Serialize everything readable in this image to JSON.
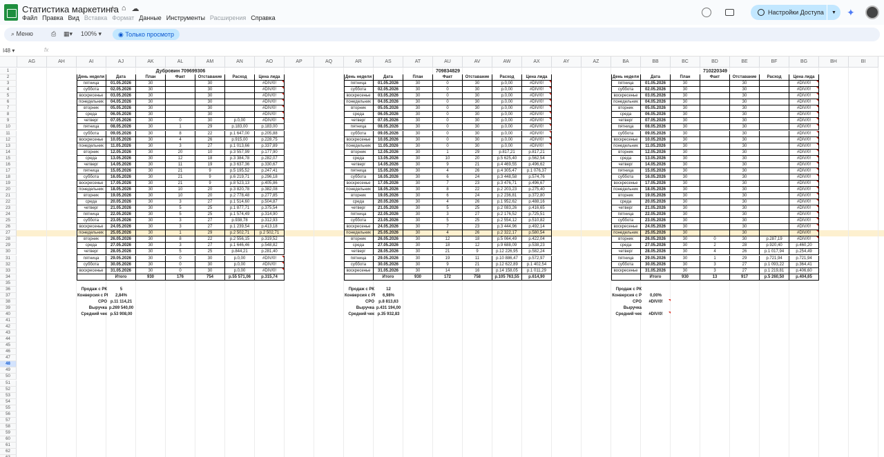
{
  "doc": {
    "title": "Статистика маркетинга",
    "menu": [
      "Файл",
      "Правка",
      "Вид",
      "Вставка",
      "Формат",
      "Данные",
      "Инструменты",
      "Расширения",
      "Справка"
    ],
    "menu_disabled": [
      3,
      4,
      7
    ]
  },
  "share": {
    "label": "Настройки Доступа"
  },
  "toolbar": {
    "search": "Меню",
    "zoom": "100%",
    "mode": "Только просмотр"
  },
  "formula": {
    "namebox": "I48",
    "fx": "fx"
  },
  "columns": [
    "AG",
    "AH",
    "AI",
    "AJ",
    "AK",
    "AL",
    "AM",
    "AN",
    "AO",
    "AP",
    "AQ",
    "AR",
    "AS",
    "AT",
    "AU",
    "AV",
    "AW",
    "AX",
    "AY",
    "AZ",
    "BA",
    "BB",
    "BC",
    "BD",
    "BE",
    "BF",
    "BG",
    "BH",
    "BI"
  ],
  "selected_row": 48,
  "highlight_row": 27,
  "headers": [
    "День недели",
    "Дата",
    "План",
    "Факт",
    "Отставание",
    "Расход",
    "Цена лида"
  ],
  "days": [
    "пятница",
    "суббота",
    "воскресенье",
    "понедельник",
    "вторник",
    "среда",
    "четверг",
    "пятница",
    "суббота",
    "воскресенье",
    "понедельник",
    "вторник",
    "среда",
    "четверг",
    "пятница",
    "суббота",
    "воскресенье",
    "понедельник",
    "вторник",
    "среда",
    "четверг",
    "пятница",
    "суббота",
    "воскресенье",
    "понедельник",
    "вторник",
    "среда",
    "четверг",
    "пятница",
    "суббота",
    "воскресенье"
  ],
  "dates": [
    "01.05.2026",
    "02.05.2026",
    "03.05.2026",
    "04.05.2026",
    "05.05.2026",
    "06.05.2026",
    "07.05.2026",
    "08.05.2026",
    "09.05.2026",
    "10.05.2026",
    "11.05.2026",
    "12.05.2026",
    "13.05.2026",
    "14.05.2026",
    "15.05.2026",
    "16.05.2026",
    "17.05.2026",
    "18.05.2026",
    "19.05.2026",
    "20.05.2026",
    "21.05.2026",
    "22.05.2026",
    "23.05.2026",
    "24.05.2026",
    "25.05.2026",
    "26.05.2026",
    "27.05.2026",
    "28.05.2026",
    "29.05.2026",
    "30.05.2026",
    "31.05.2026"
  ],
  "tables": [
    {
      "title": "Дубровин 709699306",
      "fact": [
        "",
        "",
        "",
        "",
        "",
        "",
        "0",
        "1",
        "8",
        "4",
        "3",
        "20",
        "12",
        "11",
        "21",
        "21",
        "21",
        "10",
        "10",
        "3",
        "5",
        "5",
        "3",
        "3",
        "1",
        "8",
        "3",
        "5",
        "0",
        "0",
        "0"
      ],
      "lag": [
        "30",
        "30",
        "30",
        "30",
        "30",
        "30",
        "30",
        "29",
        "22",
        "26",
        "27",
        "10",
        "18",
        "19",
        "9",
        "9",
        "9",
        "20",
        "20",
        "27",
        "25",
        "25",
        "27",
        "27",
        "29",
        "22",
        "27",
        "25",
        "30",
        "30",
        "30"
      ],
      "cost": [
        "",
        "",
        "",
        "",
        "",
        "",
        "р.0,00",
        "р.183,00",
        "р.1 647,00",
        "р.915,00",
        "р.1 013,66",
        "р.3 557,99",
        "р.3 384,78",
        "р.3 637,36",
        "р.5 195,52",
        "р.6 219,71",
        "р.8 523,13",
        "р.3 820,78",
        "р.2 778,48",
        "р.1 514,60",
        "р.1 877,71",
        "р.1 574,49",
        "р.938,78",
        "р.1 239,54",
        "р.2 502,71",
        "р.2 556,15",
        "р.1 646,46",
        "р.844,21",
        "р.0,00",
        "р.0,00",
        "р.0,00"
      ],
      "lead": [
        "#DIV/0!",
        "#DIV/0!",
        "#DIV/0!",
        "#DIV/0!",
        "#DIV/0!",
        "#DIV/0!",
        "#DIV/0!",
        "р.183,00",
        "р.205,88",
        "р.228,75",
        "р.337,89",
        "р.177,90",
        "р.282,07",
        "р.330,67",
        "р.247,41",
        "р.296,18",
        "р.405,86",
        "р.382,08",
        "р.277,85",
        "р.504,87",
        "р.375,54",
        "р.314,90",
        "р.312,93",
        "р.413,18",
        "р.2 502,71",
        "р.319,52",
        "р.548,82",
        "р.281,40",
        "#DIV/0!",
        "#DIV/0!",
        "#DIV/0!"
      ],
      "total": {
        "plan": "930",
        "fact": "176",
        "lag": "754",
        "cost": "р.55 571,06",
        "lead": "р.315,74"
      },
      "summary": [
        [
          "Продаж с РК",
          "5"
        ],
        [
          "Конверсия с РК",
          "2,84%"
        ],
        [
          "CPO",
          "р.11 114,21"
        ],
        [
          "Выручка",
          "р.269 540,00"
        ],
        [
          "Средний чек",
          "р.53 908,00"
        ]
      ]
    },
    {
      "title": "709834829",
      "fact": [
        "0",
        "0",
        "0",
        "0",
        "0",
        "0",
        "0",
        "0",
        "0",
        "0",
        "0",
        "1",
        "10",
        "9",
        "4",
        "6",
        "7",
        "8",
        "6",
        "4",
        "5",
        "3",
        "5",
        "7",
        "4",
        "12",
        "18",
        "21",
        "19",
        "9",
        "14"
      ],
      "lag": [
        "30",
        "30",
        "30",
        "30",
        "30",
        "30",
        "30",
        "30",
        "30",
        "30",
        "30",
        "29",
        "20",
        "21",
        "26",
        "24",
        "23",
        "22",
        "24",
        "26",
        "25",
        "27",
        "25",
        "23",
        "26",
        "18",
        "12",
        "9",
        "11",
        "21",
        "16"
      ],
      "cost": [
        "р.0,00",
        "р.0,00",
        "р.0,00",
        "р.0,00",
        "р.0,00",
        "р.0,00",
        "р.0,00",
        "р.0,00",
        "р.0,00",
        "р.0,00",
        "р.0,00",
        "р.817,21",
        "р.5 625,40",
        "р.4 469,55",
        "р.4 305,47",
        "р.3 448,58",
        "р.3 476,71",
        "р.2 203,23",
        "р.2 236,81",
        "р.1 952,62",
        "р.2 083,26",
        "р.2 176,52",
        "р.2 554,12",
        "р.3 444,96",
        "р.2 322,17",
        "р.5 064,49",
        "р.9 688,09",
        "р.12 226,95",
        "р.10 886,47",
        "р.12 622,89",
        "р.14 158,05"
      ],
      "lead": [
        "#DIV/0!",
        "#DIV/0!",
        "#DIV/0!",
        "#DIV/0!",
        "#DIV/0!",
        "#DIV/0!",
        "#DIV/0!",
        "#DIV/0!",
        "#DIV/0!",
        "#DIV/0!",
        "#DIV/0!",
        "р.817,21",
        "р.562,54",
        "р.496,62",
        "р.1 076,37",
        "р.574,76",
        "р.496,67",
        "р.275,40",
        "р.372,80",
        "р.488,16",
        "р.416,65",
        "р.725,51",
        "р.510,82",
        "р.492,14",
        "р.580,54",
        "р.422,04",
        "р.538,23",
        "р.582,24",
        "р.572,97",
        "р.1 402,54",
        "р.1 011,29"
      ],
      "total": {
        "plan": "930",
        "fact": "172",
        "lag": "758",
        "cost": "р.105 763,55",
        "lead": "р.614,90"
      },
      "summary": [
        [
          "Продаж с РК",
          "12"
        ],
        [
          "Конверсия с РК",
          "6,98%"
        ],
        [
          "CPO",
          "р.8 813,63"
        ],
        [
          "Выручка",
          "р.431 194,00"
        ],
        [
          "Средний чек",
          "р.35 932,83"
        ]
      ]
    },
    {
      "title": "710220349",
      "fact": [
        "",
        "",
        "",
        "",
        "",
        "",
        "",
        "",
        "",
        "",
        "",
        "",
        "",
        "",
        "",
        "",
        "",
        "",
        "",
        "",
        "",
        "",
        "",
        "",
        "",
        "0",
        "2",
        "4",
        "1",
        "3",
        "3"
      ],
      "lag": [
        "30",
        "30",
        "30",
        "30",
        "30",
        "30",
        "30",
        "30",
        "30",
        "30",
        "30",
        "30",
        "30",
        "30",
        "30",
        "30",
        "30",
        "30",
        "30",
        "30",
        "30",
        "30",
        "30",
        "30",
        "30",
        "30",
        "28",
        "26",
        "29",
        "27",
        "27"
      ],
      "cost": [
        "",
        "",
        "",
        "",
        "",
        "",
        "",
        "",
        "",
        "",
        "",
        "",
        "",
        "",
        "",
        "",
        "",
        "",
        "",
        "",
        "",
        "",
        "",
        "",
        "",
        "р.287,19",
        "р.920,40",
        "р.1 017,94",
        "р.721,94",
        "р.1 093,22",
        "р.1 219,81"
      ],
      "lead": [
        "#DIV/0!",
        "#DIV/0!",
        "#DIV/0!",
        "#DIV/0!",
        "#DIV/0!",
        "#DIV/0!",
        "#DIV/0!",
        "#DIV/0!",
        "#DIV/0!",
        "#DIV/0!",
        "#DIV/0!",
        "#DIV/0!",
        "#DIV/0!",
        "#DIV/0!",
        "#DIV/0!",
        "#DIV/0!",
        "#DIV/0!",
        "#DIV/0!",
        "#DIV/0!",
        "#DIV/0!",
        "#DIV/0!",
        "#DIV/0!",
        "#DIV/0!",
        "#DIV/0!",
        "#DIV/0!",
        "#DIV/0!",
        "р.460,20",
        "р.254,49",
        "р.721,94",
        "р.364,41",
        "р.406,60"
      ],
      "total": {
        "plan": "930",
        "fact": "13",
        "lag": "917",
        "cost": "р.5 260,50",
        "lead": "р.404,65"
      },
      "summary": [
        [
          "Продаж с РК",
          ""
        ],
        [
          "Конверсия с Р",
          "0,00%"
        ],
        [
          "CPO",
          "#DIV/0!"
        ],
        [
          "Выручка",
          ""
        ],
        [
          "Средний чек",
          "#DIV/0!"
        ]
      ]
    }
  ]
}
